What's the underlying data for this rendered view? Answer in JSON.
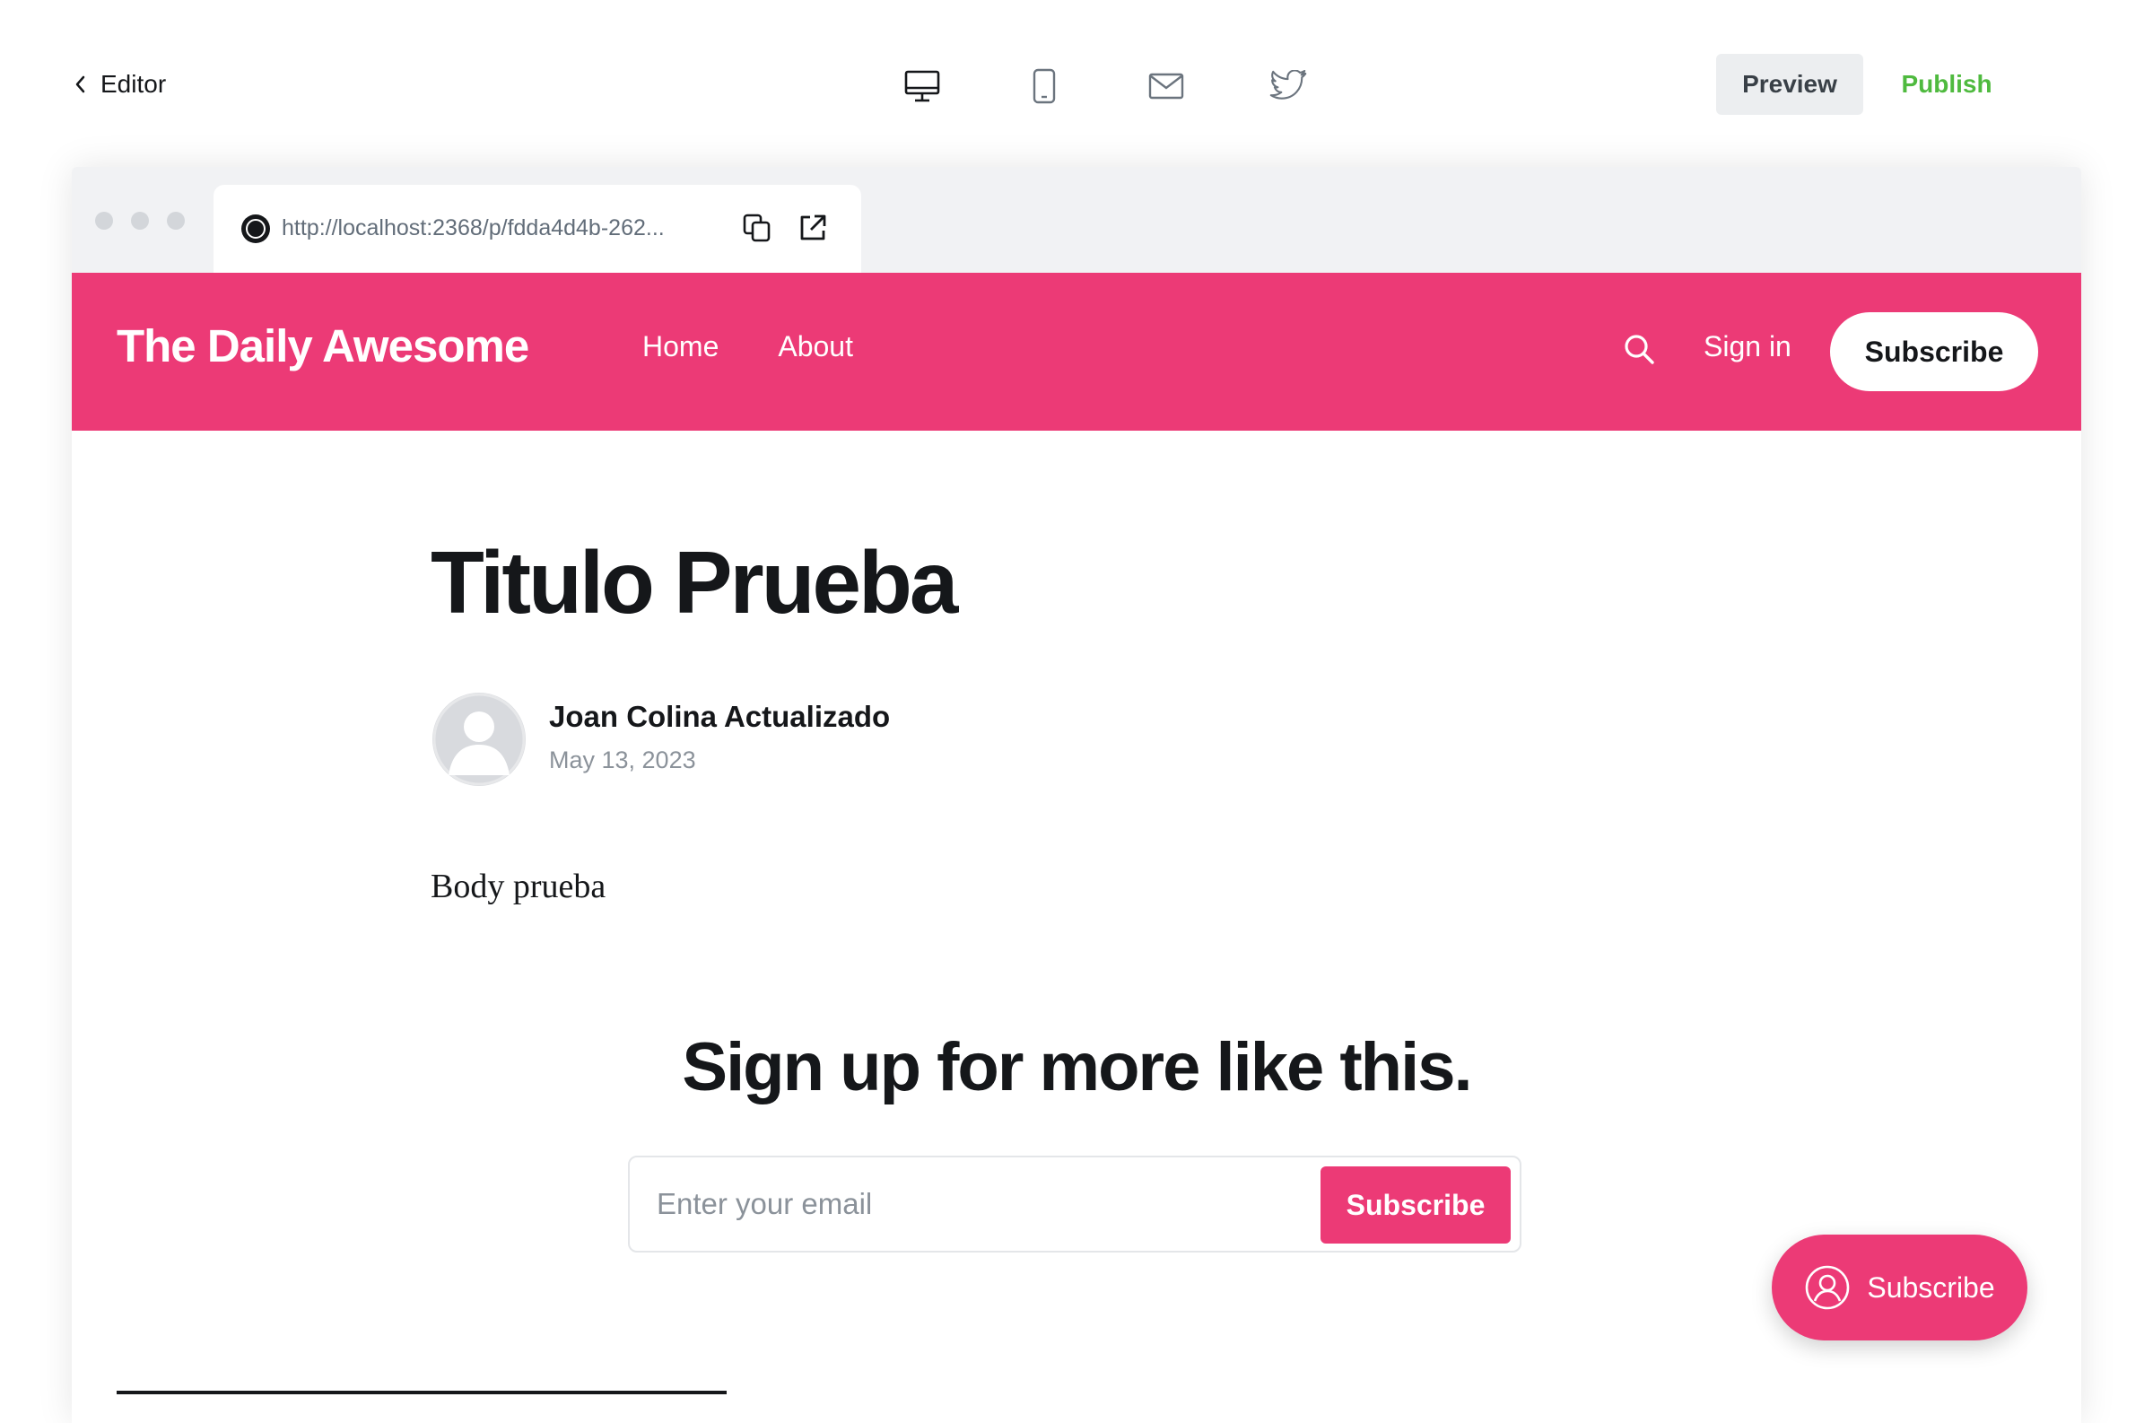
{
  "editor": {
    "back_label": "Editor",
    "devices": [
      "desktop-icon",
      "mobile-icon",
      "email-icon",
      "twitter-icon"
    ],
    "preview_label": "Preview",
    "publish_label": "Publish",
    "publish_color": "#4fba3f"
  },
  "browser": {
    "url": "http://localhost:2368/p/fdda4d4b-262..."
  },
  "site": {
    "title": "The Daily Awesome",
    "accent_color": "#ec3a76",
    "nav": [
      "Home",
      "About"
    ],
    "signin_label": "Sign in",
    "subscribe_label": "Subscribe"
  },
  "post": {
    "title": "Titulo Prueba",
    "author": "Joan Colina Actualizado",
    "date": "May 13, 2023",
    "body": "Body prueba"
  },
  "cta": {
    "title": "Sign up for more like this.",
    "email_placeholder": "Enter your email",
    "button_label": "Subscribe"
  },
  "portal": {
    "label": "Subscribe"
  }
}
